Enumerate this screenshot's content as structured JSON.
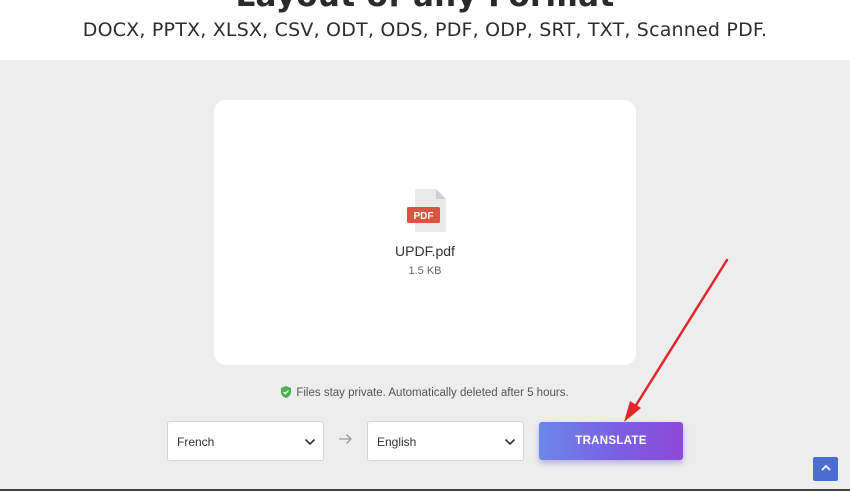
{
  "header": {
    "title": "Layout of any Format",
    "formats": "DOCX, PPTX, XLSX, CSV, ODT, ODS, PDF, ODP, SRT, TXT, Scanned PDF."
  },
  "file": {
    "badge": "PDF",
    "name": "UPDF.pdf",
    "size": "1.5 KB",
    "icon": "pdf-file-icon"
  },
  "privacy": {
    "text": "Files stay private. Automatically deleted after 5 hours.",
    "icon": "shield-check-icon"
  },
  "translator": {
    "source_language": "French",
    "target_language": "English",
    "swap_icon": "right-arrow-icon",
    "button_label": "TRANSLATE"
  },
  "scroll_top": {
    "icon": "chevron-up-icon"
  },
  "colors": {
    "background": "#ededee",
    "button_gradient_start": "#6b87ea",
    "button_gradient_end": "#8e49d6",
    "annotation_arrow": "#e3262b",
    "pdf_badge": "#d9553f",
    "shield": "#4caf50",
    "scroll_button": "#4a6ed0"
  }
}
